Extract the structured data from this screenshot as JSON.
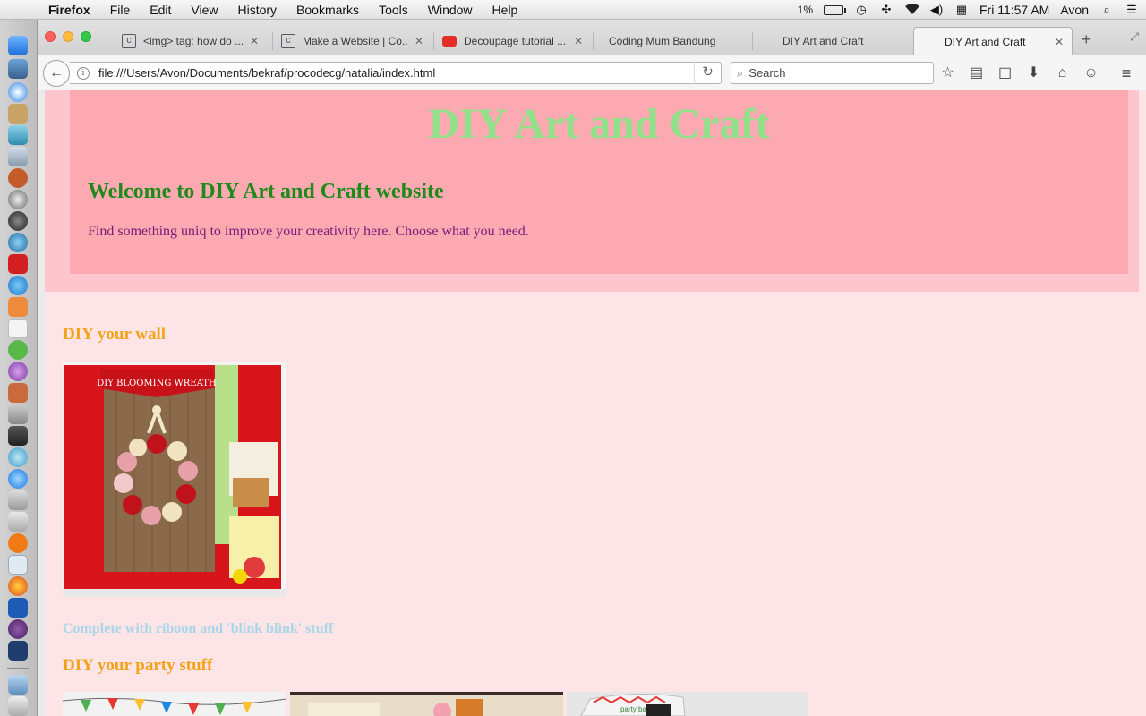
{
  "menubar": {
    "app": "Firefox",
    "items": [
      "File",
      "Edit",
      "View",
      "History",
      "Bookmarks",
      "Tools",
      "Window",
      "Help"
    ],
    "battery_pct": "1%",
    "clock": "Fri 11:57 AM",
    "user": "Avon"
  },
  "tabs": [
    {
      "label": "<img> tag: how do ...",
      "icon": "codecademy-icon"
    },
    {
      "label": "Make a Website | Co...",
      "icon": "codecademy-icon"
    },
    {
      "label": "Decoupage tutorial ...",
      "icon": "youtube-icon"
    },
    {
      "label": "Coding Mum Bandung",
      "icon": "page-icon"
    },
    {
      "label": "DIY Art and Craft",
      "icon": "page-icon"
    },
    {
      "label": "DIY Art and Craft",
      "icon": "page-icon",
      "active": true
    }
  ],
  "navbar": {
    "url": "file:///Users/Avon/Documents/bekraf/procodecg/natalia/index.html",
    "search_placeholder": "Search"
  },
  "page": {
    "title": "DIY Art and Craft",
    "welcome": "Welcome to DIY Art and Craft website",
    "tagline": "Find something uniq to improve your creativity here. Choose what you need.",
    "sections": [
      {
        "heading": "DIY your wall",
        "caption": "Complete with riboon and 'blink blink' stuff"
      },
      {
        "heading": "DIY your party stuff"
      }
    ],
    "wreath_image_text": {
      "title": "DIY BLOOMING WREATH"
    },
    "party_banner_text": "party banners"
  },
  "colors": {
    "title_green": "#93e08a",
    "welcome_green": "#1e8a1a",
    "tagline_purple": "#7c1a78",
    "section_orange": "#f5a21b",
    "caption_blue": "#a9d6e8",
    "header_pink": "#fca9b2",
    "page_bg": "#fde4e6"
  }
}
